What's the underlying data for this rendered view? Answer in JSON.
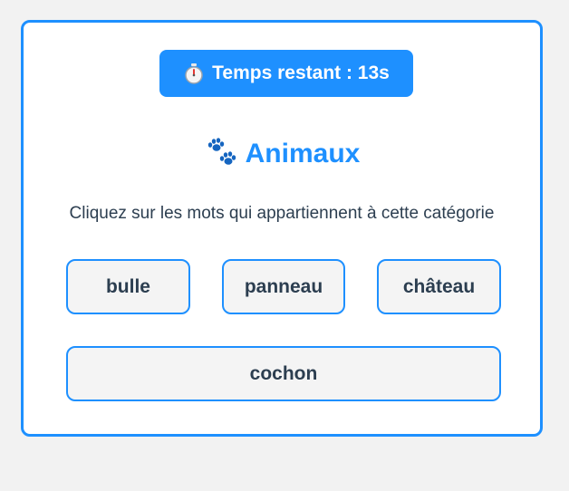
{
  "timer": {
    "label": "Temps restant : 13s",
    "icon": "stopwatch-icon"
  },
  "category": {
    "title": "Animaux",
    "icon": "paw-prints-icon"
  },
  "instruction": "Cliquez sur les mots qui appartiennent à cette catégorie",
  "words": [
    "bulle",
    "panneau",
    "château",
    "cochon"
  ],
  "colors": {
    "accent": "#1e90ff",
    "text": "#2c3e50",
    "button_bg": "#f4f4f4",
    "page_bg": "#f2f2f2"
  }
}
